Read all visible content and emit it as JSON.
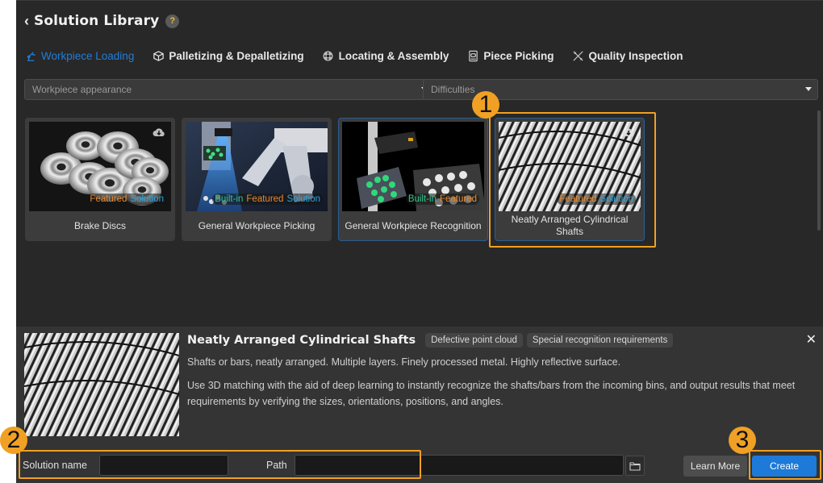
{
  "header": {
    "back_icon": "chevron-left-icon",
    "title": "Solution Library",
    "help_icon": "?"
  },
  "tabs": [
    {
      "label": "Workpiece Loading",
      "icon": "robot-arm-icon",
      "active": true
    },
    {
      "label": "Palletizing & Depalletizing",
      "icon": "box-icon",
      "active": false
    },
    {
      "label": "Locating & Assembly",
      "icon": "gear-icon",
      "active": false
    },
    {
      "label": "Piece Picking",
      "icon": "package-icon",
      "active": false
    },
    {
      "label": "Quality Inspection",
      "icon": "tools-icon",
      "active": false
    }
  ],
  "filters": {
    "appearance_placeholder": "Workpiece appearance",
    "difficulties_placeholder": "Difficulties"
  },
  "cards": [
    {
      "name": "Brake Discs",
      "badges": [
        "Featured",
        "Solution"
      ],
      "download": true,
      "selected": false
    },
    {
      "name": "General Workpiece Picking",
      "badges": [
        "Built-in",
        "Featured",
        "Solution"
      ],
      "download": false,
      "selected": false
    },
    {
      "name": "General Workpiece Recognition",
      "badges": [
        "Built-in",
        "Featured"
      ],
      "download": false,
      "selected": true
    },
    {
      "name": "Neatly Arranged Cylindrical Shafts",
      "badges": [
        "Featured",
        "Solution"
      ],
      "download": true,
      "selected": true
    }
  ],
  "detail": {
    "title": "Neatly Arranged Cylindrical Shafts",
    "chips": [
      "Defective point cloud",
      "Special recognition requirements"
    ],
    "description": "Shafts or bars, neatly arranged. Multiple layers. Finely processed metal. Highly reflective surface.",
    "body": "Use 3D matching with the aid of deep learning to instantly recognize the shafts/bars from the incoming bins, and output results that meet requirements by verifying the sizes, orientations, positions, and angles.",
    "close": "✕"
  },
  "form": {
    "solution_name_label": "Solution name",
    "solution_name_value": "",
    "path_label": "Path",
    "path_value": "",
    "learn_more": "Learn More",
    "create": "Create"
  },
  "callouts": [
    "1",
    "2",
    "3"
  ],
  "colors": {
    "accent_blue": "#1d7ad8",
    "callout_orange": "#f0a024",
    "badge_builtin": "#33c28a",
    "badge_featured": "#e88a2c",
    "badge_solution": "#2ea6dd"
  }
}
